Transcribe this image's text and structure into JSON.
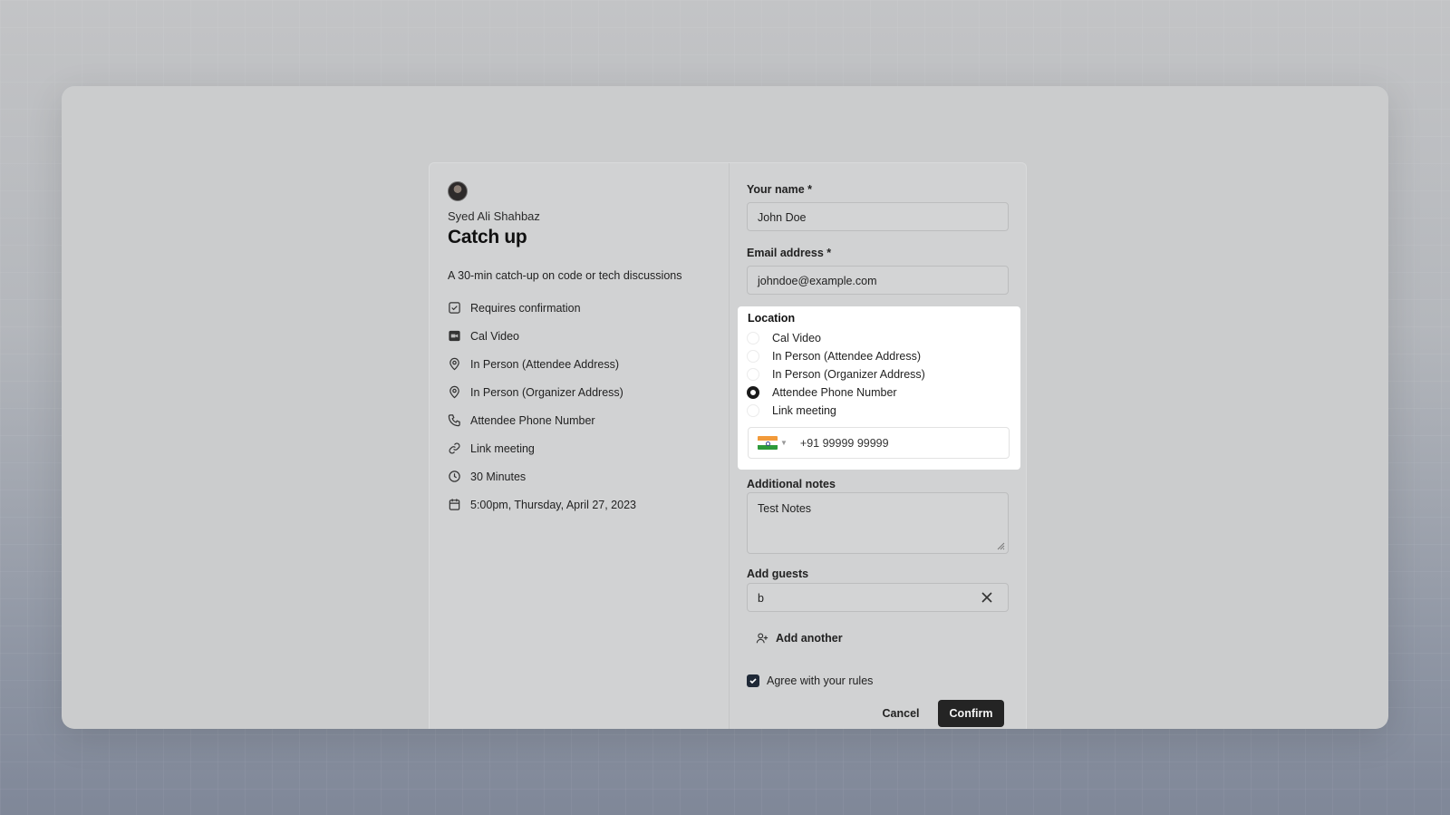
{
  "organizer": {
    "name": "Syed Ali Shahbaz"
  },
  "event": {
    "title": "Catch up",
    "description": "A 30-min catch-up on code or tech discussions",
    "details": [
      {
        "icon": "check-square-icon",
        "label": "Requires confirmation"
      },
      {
        "icon": "video-icon",
        "label": "Cal Video"
      },
      {
        "icon": "map-pin-icon",
        "label": "In Person (Attendee Address)"
      },
      {
        "icon": "map-pin-icon",
        "label": "In Person (Organizer Address)"
      },
      {
        "icon": "phone-icon",
        "label": "Attendee Phone Number"
      },
      {
        "icon": "link-icon",
        "label": "Link meeting"
      },
      {
        "icon": "clock-icon",
        "label": "30 Minutes"
      },
      {
        "icon": "calendar-icon",
        "label": "5:00pm, Thursday, April 27, 2023"
      }
    ]
  },
  "form": {
    "name_label": "Your name *",
    "name_value": "John Doe",
    "email_label": "Email address *",
    "email_value": "johndoe@example.com",
    "location": {
      "label": "Location",
      "options": [
        {
          "label": "Cal Video",
          "selected": false
        },
        {
          "label": "In Person (Attendee Address)",
          "selected": false
        },
        {
          "label": "In Person (Organizer Address)",
          "selected": false
        },
        {
          "label": "Attendee Phone Number",
          "selected": true
        },
        {
          "label": "Link meeting",
          "selected": false
        }
      ],
      "phone_country": "India",
      "phone_value": "+91 99999 99999"
    },
    "notes_label": "Additional notes",
    "notes_value": "Test Notes",
    "guests_label": "Add guests",
    "guest_value": "b",
    "add_another_label": "Add another",
    "agree_label": "Agree with your rules",
    "agree_checked": true,
    "cancel_label": "Cancel",
    "confirm_label": "Confirm"
  }
}
